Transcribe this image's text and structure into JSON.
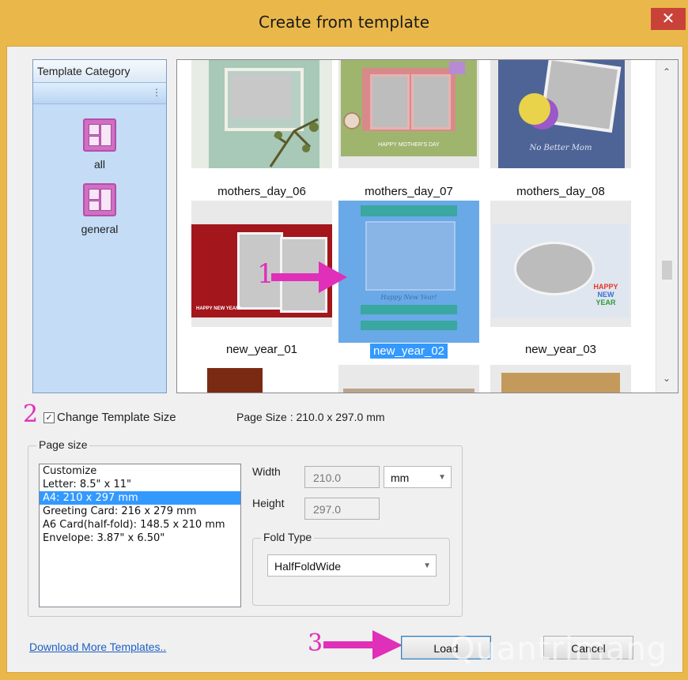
{
  "window": {
    "title": "Create from template",
    "close_symbol": "✕"
  },
  "category": {
    "header": "Template Category",
    "grip": "⋮",
    "items": [
      {
        "label": "all"
      },
      {
        "label": "general"
      }
    ]
  },
  "templates": [
    {
      "name": "mothers_day_06"
    },
    {
      "name": "mothers_day_07"
    },
    {
      "name": "mothers_day_08"
    },
    {
      "name": "new_year_01"
    },
    {
      "name": "new_year_02",
      "selected": true
    },
    {
      "name": "new_year_03"
    }
  ],
  "thumb_art_text": {
    "happy_mothers_day": "HAPPY MOTHER'S DAY",
    "no_better_mom": "No Better Mom",
    "happy_new_year_small": "HAPPY NEW YEAR!",
    "happy_new_year_script": "Happy New Year!",
    "happy_new_year_stack": [
      "HAPPY",
      "NEW",
      "YEAR"
    ]
  },
  "scroll": {
    "up": "⌃",
    "down": "⌄"
  },
  "options": {
    "change_size_label": "Change Template Size",
    "change_size_checked": true,
    "checkmark": "✓",
    "page_size_info": "Page Size : 210.0 x 297.0 mm"
  },
  "page_size": {
    "group_title": "Page size",
    "items": [
      "Customize",
      "Letter: 8.5\" x 11\"",
      "A4: 210 x 297 mm",
      "Greeting Card: 216 x 279 mm",
      "A6 Card(half-fold): 148.5 x 210 mm",
      "Envelope: 3.87\" x 6.50\""
    ],
    "selected_index": 2,
    "width_label": "Width",
    "width_value": "210.0",
    "unit": "mm",
    "height_label": "Height",
    "height_value": "297.0",
    "fold_title": "Fold Type",
    "fold_value": "HalfFoldWide",
    "dropdown_arrow": "▼"
  },
  "footer": {
    "download_link": "Download More Templates..",
    "load_label": "Load",
    "cancel_label": "Cancel"
  },
  "annotations": {
    "one": "1",
    "two": "2",
    "three": "3"
  },
  "watermark": "Quantrimang",
  "colors": {
    "accent": "#3399ff",
    "annotation": "#e02fb8",
    "title_bar": "#eab84a",
    "close": "#c9423a"
  }
}
